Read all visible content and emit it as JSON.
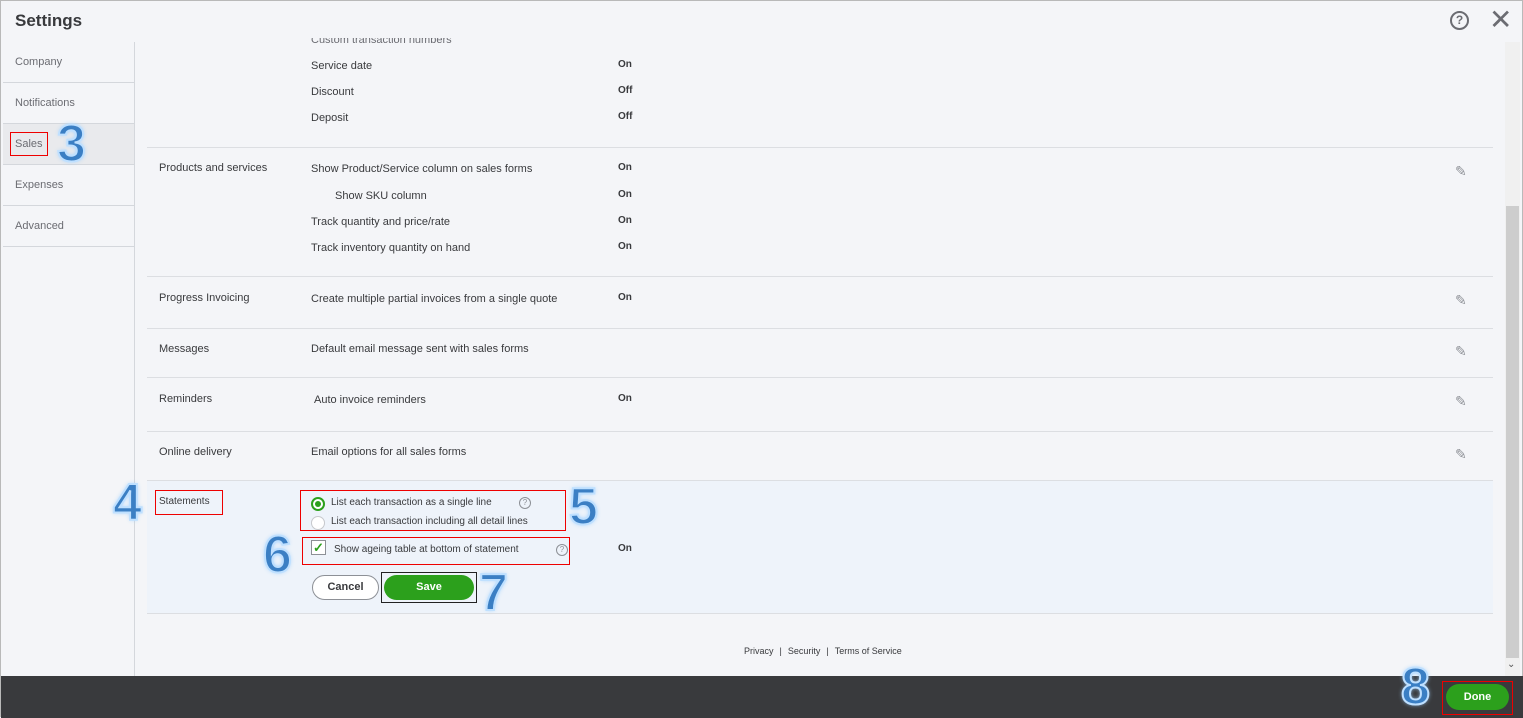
{
  "header": {
    "title": "Settings",
    "help_icon": "?",
    "close_icon": "✕"
  },
  "sidebar": {
    "items": [
      {
        "label": "Company"
      },
      {
        "label": "Notifications"
      },
      {
        "label": "Sales"
      },
      {
        "label": "Expenses"
      },
      {
        "label": "Advanced"
      }
    ]
  },
  "sections": {
    "custom_fields": {
      "partial_label": "Custom transaction numbers",
      "rows": [
        {
          "label": "Service date",
          "value": "On"
        },
        {
          "label": "Discount",
          "value": "Off"
        },
        {
          "label": "Deposit",
          "value": "Off"
        }
      ]
    },
    "products": {
      "title": "Products and services",
      "rows": [
        {
          "label": "Show Product/Service column on sales forms",
          "value": "On"
        },
        {
          "label": "Show SKU column",
          "value": "On"
        },
        {
          "label": "Track quantity and price/rate",
          "value": "On"
        },
        {
          "label": "Track inventory quantity on hand",
          "value": "On"
        }
      ]
    },
    "progress": {
      "title": "Progress Invoicing",
      "label": "Create multiple partial invoices from a single quote",
      "value": "On"
    },
    "messages": {
      "title": "Messages",
      "label": "Default email message sent with sales forms"
    },
    "reminders": {
      "title": "Reminders",
      "label": "Auto invoice reminders",
      "value": "On"
    },
    "online": {
      "title": "Online delivery",
      "label": "Email options for all sales forms"
    },
    "statements": {
      "title": "Statements",
      "option1": "List each transaction as a single line",
      "option2": "List each transaction including all detail lines",
      "selected_option": 1,
      "ageing_label": "Show ageing table at bottom of statement",
      "ageing_checked": true,
      "ageing_value": "On",
      "cancel": "Cancel",
      "save": "Save"
    }
  },
  "footer": {
    "privacy": "Privacy",
    "security": "Security",
    "terms": "Terms of Service",
    "sep": "|",
    "done": "Done"
  },
  "annotations": [
    "3",
    "4",
    "5",
    "6",
    "7",
    "8"
  ],
  "colors": {
    "accent": "#2ca01c",
    "annotation": "#3b7fc4",
    "highlight": "#e00000"
  }
}
